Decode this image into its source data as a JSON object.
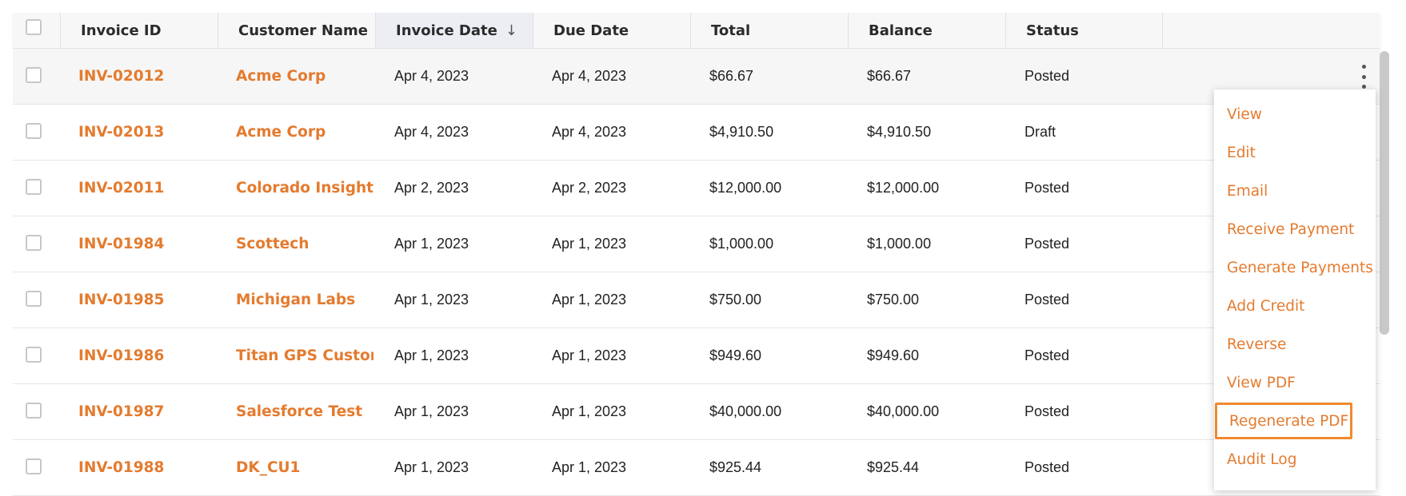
{
  "columns": [
    {
      "label": "Invoice ID"
    },
    {
      "label": "Customer Name"
    },
    {
      "label": "Invoice Date",
      "sort_icon": "arrow-down-icon"
    },
    {
      "label": "Due Date"
    },
    {
      "label": "Total"
    },
    {
      "label": "Balance"
    },
    {
      "label": "Status"
    }
  ],
  "rows": [
    {
      "invoice_id": "INV-02012",
      "customer": "Acme Corp",
      "invoice_date": "Apr 4, 2023",
      "due_date": "Apr 4, 2023",
      "total": "$66.67",
      "balance": "$66.67",
      "status": "Posted"
    },
    {
      "invoice_id": "INV-02013",
      "customer": "Acme Corp",
      "invoice_date": "Apr 4, 2023",
      "due_date": "Apr 4, 2023",
      "total": "$4,910.50",
      "balance": "$4,910.50",
      "status": "Draft"
    },
    {
      "invoice_id": "INV-02011",
      "customer": "Colorado Insights",
      "invoice_date": "Apr 2, 2023",
      "due_date": "Apr 2, 2023",
      "total": "$12,000.00",
      "balance": "$12,000.00",
      "status": "Posted"
    },
    {
      "invoice_id": "INV-01984",
      "customer": "Scottech",
      "invoice_date": "Apr 1, 2023",
      "due_date": "Apr 1, 2023",
      "total": "$1,000.00",
      "balance": "$1,000.00",
      "status": "Posted"
    },
    {
      "invoice_id": "INV-01985",
      "customer": "Michigan Labs",
      "invoice_date": "Apr 1, 2023",
      "due_date": "Apr 1, 2023",
      "total": "$750.00",
      "balance": "$750.00",
      "status": "Posted"
    },
    {
      "invoice_id": "INV-01986",
      "customer": "Titan GPS Customer X",
      "invoice_date": "Apr 1, 2023",
      "due_date": "Apr 1, 2023",
      "total": "$949.60",
      "balance": "$949.60",
      "status": "Posted"
    },
    {
      "invoice_id": "INV-01987",
      "customer": "Salesforce Test",
      "invoice_date": "Apr 1, 2023",
      "due_date": "Apr 1, 2023",
      "total": "$40,000.00",
      "balance": "$40,000.00",
      "status": "Posted"
    },
    {
      "invoice_id": "INV-01988",
      "customer": "DK_CU1",
      "invoice_date": "Apr 1, 2023",
      "due_date": "Apr 1, 2023",
      "total": "$925.44",
      "balance": "$925.44",
      "status": "Posted"
    }
  ],
  "row_menu": {
    "items": [
      "View",
      "Edit",
      "Email",
      "Receive Payment",
      "Generate Payments",
      "Add Credit",
      "Reverse",
      "View PDF",
      "Regenerate PDF",
      "Audit Log"
    ],
    "highlighted": "Regenerate PDF"
  },
  "icons": {
    "sort": "arrow-down-icon",
    "row_actions": "more-vertical-icon"
  },
  "colors": {
    "accent": "#e47b2f",
    "highlight_border": "#f0892f",
    "header_bg": "#f7f7f7",
    "sorted_header_bg": "#eceef4"
  }
}
